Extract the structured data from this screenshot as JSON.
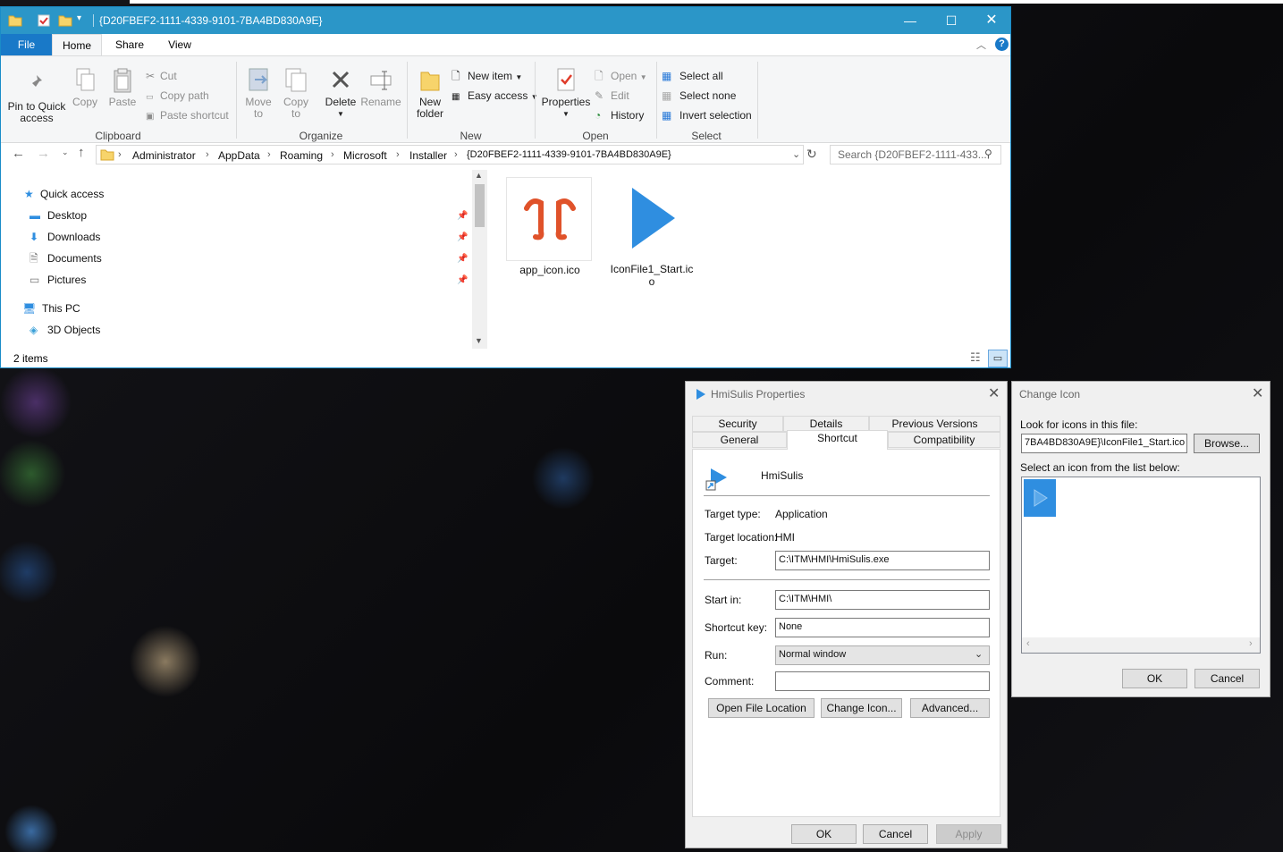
{
  "explorer": {
    "title": "{D20FBEF2-1111-4339-9101-7BA4BD830A9E}",
    "tabs": {
      "file": "File",
      "home": "Home",
      "share": "Share",
      "view": "View"
    },
    "clipboard": {
      "pin": "Pin to Quick access",
      "copy": "Copy",
      "paste": "Paste",
      "cut": "Cut",
      "copy_path": "Copy path",
      "paste_shortcut": "Paste shortcut",
      "group": "Clipboard"
    },
    "organize": {
      "move_to": "Move to",
      "copy_to": "Copy to",
      "delete": "Delete",
      "rename": "Rename",
      "group": "Organize"
    },
    "new": {
      "new_folder": "New folder",
      "new_item": "New item",
      "easy_access": "Easy access",
      "group": "New"
    },
    "open": {
      "properties": "Properties",
      "open": "Open",
      "edit": "Edit",
      "history": "History",
      "group": "Open"
    },
    "select": {
      "select_all": "Select all",
      "select_none": "Select none",
      "invert": "Invert selection",
      "group": "Select"
    },
    "breadcrumbs": [
      "Administrator",
      "AppData",
      "Roaming",
      "Microsoft",
      "Installer",
      "{D20FBEF2-1111-4339-9101-7BA4BD830A9E}"
    ],
    "search_placeholder": "Search {D20FBEF2-1111-433...",
    "nav": {
      "quick_access": "Quick access",
      "desktop": "Desktop",
      "downloads": "Downloads",
      "documents": "Documents",
      "pictures": "Pictures",
      "this_pc": "This PC",
      "objects3d": "3D Objects"
    },
    "files": [
      {
        "name": "app_icon.ico"
      },
      {
        "name": "IconFile1_Start.ic o"
      }
    ],
    "status": "2 items"
  },
  "properties": {
    "title": "HmiSulis Properties",
    "tabs": {
      "security": "Security",
      "details": "Details",
      "previous_versions": "Previous Versions",
      "general": "General",
      "shortcut": "Shortcut",
      "compatibility": "Compatibility"
    },
    "name": "HmiSulis",
    "target_type_label": "Target type:",
    "target_type": "Application",
    "target_location_label": "Target location:",
    "target_location": "HMI",
    "target_label": "Target:",
    "target": "C:\\ITM\\HMI\\HmiSulis.exe",
    "start_in_label": "Start in:",
    "start_in": "C:\\ITM\\HMI\\",
    "shortcut_key_label": "Shortcut key:",
    "shortcut_key": "None",
    "run_label": "Run:",
    "run": "Normal window",
    "comment_label": "Comment:",
    "comment": "",
    "open_file_location": "Open File Location",
    "change_icon": "Change Icon...",
    "advanced": "Advanced...",
    "ok": "OK",
    "cancel": "Cancel",
    "apply": "Apply"
  },
  "change_icon": {
    "title": "Change Icon",
    "look_label": "Look for icons in this file:",
    "file_path": "7BA4BD830A9E}\\IconFile1_Start.ico",
    "browse": "Browse...",
    "list_label": "Select an icon from the list below:",
    "ok": "OK",
    "cancel": "Cancel"
  },
  "colors": {
    "titlebar": "#2b96c8",
    "file_tab": "#1979c8",
    "icon_orange": "#e0522a",
    "icon_blue": "#2f8ee0"
  }
}
